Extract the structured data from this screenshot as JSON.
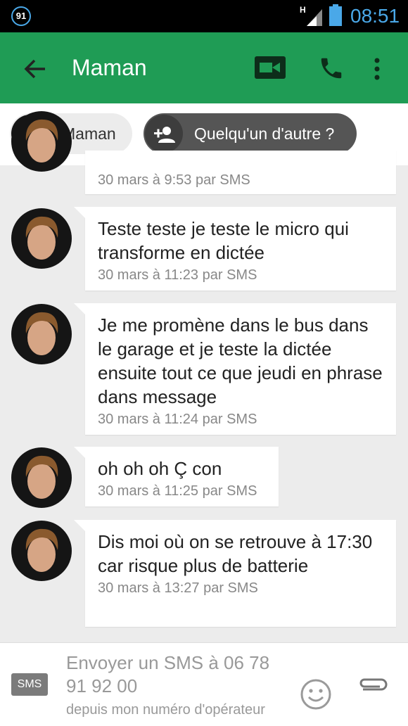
{
  "status_bar": {
    "notification_count": "91",
    "network_type": "H",
    "time": "08:51",
    "icons": [
      "notification-badge-icon",
      "signal-icon",
      "battery-icon"
    ]
  },
  "app_bar": {
    "title": "Maman",
    "icons": [
      "back-arrow-icon",
      "video-call-icon",
      "phone-icon",
      "more-vert-icon"
    ],
    "color": "#1f9c55"
  },
  "participants": {
    "contact_label": "Maman",
    "add_label": "Quelqu'un d'autre ?"
  },
  "messages": [
    {
      "meta": "30 mars à 9:53 par SMS"
    },
    {
      "text": "Teste teste je teste le micro qui transforme en dictée",
      "meta": "30 mars à 11:23 par SMS"
    },
    {
      "text": "Je me promène dans le bus dans le garage et je teste la dictée ensuite tout ce que jeudi en phrase dans message",
      "meta": "30 mars à 11:24 par SMS"
    },
    {
      "text": "oh oh oh Ç con",
      "meta": "30 mars à 11:25 par SMS"
    },
    {
      "text": "Dis moi où on se retrouve à 17:30 car risque plus de batterie",
      "meta": "30 mars à 13:27 par SMS"
    }
  ],
  "compose": {
    "sms_label": "SMS",
    "placeholder": "Envoyer un SMS à 06 78 91 92 00",
    "subnote": "depuis mon numéro d'opérateur",
    "icons": [
      "emoji-icon",
      "attach-icon"
    ]
  },
  "colors": {
    "accent": "#1f9c55",
    "status_blue": "#4aa8e8",
    "background": "#ececec"
  }
}
